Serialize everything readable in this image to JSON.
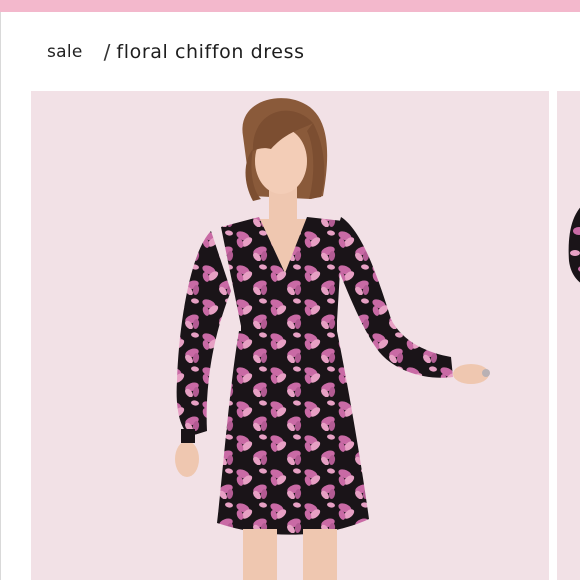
{
  "header": {
    "accent_color": "#f3b8cc"
  },
  "breadcrumb": {
    "items": [
      {
        "label": "sale"
      },
      {
        "separator": "/",
        "label": "floral chiffon dress"
      }
    ]
  },
  "gallery": {
    "background_color": "#f2e1e6",
    "dress_colors": {
      "base": "#1a1418",
      "petal": "#c96aa5",
      "petal_light": "#e7a0c4"
    }
  }
}
